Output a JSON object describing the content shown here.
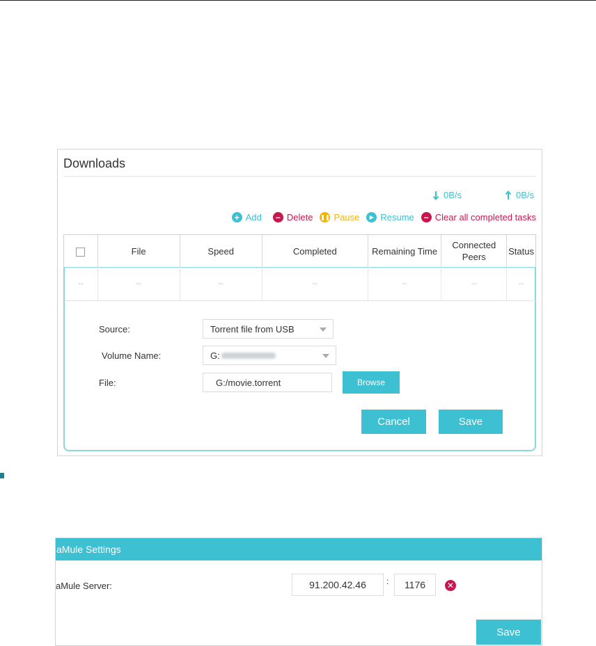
{
  "downloads": {
    "title": "Downloads",
    "download_rate": "0B/s",
    "upload_rate": "0B/s",
    "actions": {
      "add": "Add",
      "delete": "Delete",
      "pause": "Pause",
      "resume": "Resume",
      "clear": "Clear all completed tasks"
    },
    "columns": [
      "File",
      "Speed",
      "Completed",
      "Remaining Time",
      "Connected Peers",
      "Status"
    ],
    "empty_row": [
      "--",
      "--",
      "--",
      "--",
      "--",
      "--",
      "--"
    ],
    "form": {
      "source_label": "Source:",
      "source_value": "Torrent file from USB",
      "volume_label": "Volume Name:",
      "volume_value": "G:",
      "file_label": "File:",
      "file_value": "G:/movie.torrent",
      "browse": "Browse",
      "cancel": "Cancel",
      "save": "Save"
    },
    "colors": {
      "accent": "#3dc0d2",
      "delete": "#c8174f",
      "pause": "#f5b400",
      "clear": "#c8174f"
    }
  },
  "amule": {
    "title": "aMule Settings",
    "server_label": "aMule Server:",
    "server_ip": "91.200.42.46",
    "separator": ":",
    "server_port": "1176",
    "save": "Save"
  }
}
